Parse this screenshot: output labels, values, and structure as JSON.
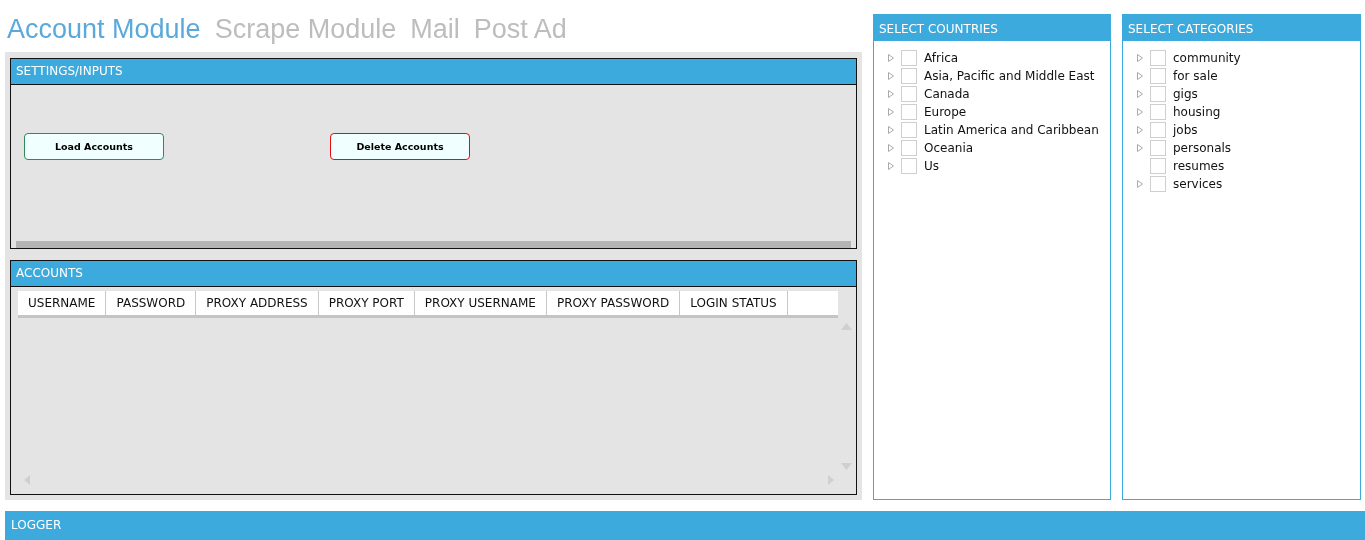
{
  "tabs": [
    {
      "label": "Account Module",
      "selected": true
    },
    {
      "label": "Scrape Module",
      "selected": false
    },
    {
      "label": "Mail",
      "selected": false
    },
    {
      "label": "Post Ad",
      "selected": false
    }
  ],
  "settings": {
    "title": "SETTINGS/INPUTS",
    "buttons": [
      {
        "label": "Load Accounts",
        "kind": "load"
      },
      {
        "label": "Delete Accounts",
        "kind": "delete"
      }
    ]
  },
  "accounts": {
    "title": "ACCOUNTS",
    "columns": [
      "USERNAME",
      "PASSWORD",
      "PROXY ADDRESS",
      "PROXY PORT",
      "PROXY USERNAME",
      "PROXY PASSWORD",
      "LOGIN STATUS"
    ]
  },
  "countries": {
    "title": "SELECT COUNTRIES",
    "items": [
      {
        "label": "Africa",
        "expandable": true,
        "checked": false
      },
      {
        "label": "Asia, Pacific and Middle East",
        "expandable": true,
        "checked": false
      },
      {
        "label": "Canada",
        "expandable": true,
        "checked": false
      },
      {
        "label": "Europe",
        "expandable": true,
        "checked": false
      },
      {
        "label": "Latin America and Caribbean",
        "expandable": true,
        "checked": false
      },
      {
        "label": "Oceania",
        "expandable": true,
        "checked": false
      },
      {
        "label": "Us",
        "expandable": true,
        "checked": false
      }
    ]
  },
  "categories": {
    "title": "SELECT CATEGORIES",
    "items": [
      {
        "label": "community",
        "expandable": true,
        "checked": false
      },
      {
        "label": "for sale",
        "expandable": true,
        "checked": false
      },
      {
        "label": "gigs",
        "expandable": true,
        "checked": false
      },
      {
        "label": "housing",
        "expandable": true,
        "checked": false
      },
      {
        "label": "jobs",
        "expandable": true,
        "checked": false
      },
      {
        "label": "personals",
        "expandable": true,
        "checked": false
      },
      {
        "label": "resumes",
        "expandable": false,
        "checked": false
      },
      {
        "label": "services",
        "expandable": true,
        "checked": false
      }
    ]
  },
  "logger": {
    "title": "LOGGER"
  }
}
